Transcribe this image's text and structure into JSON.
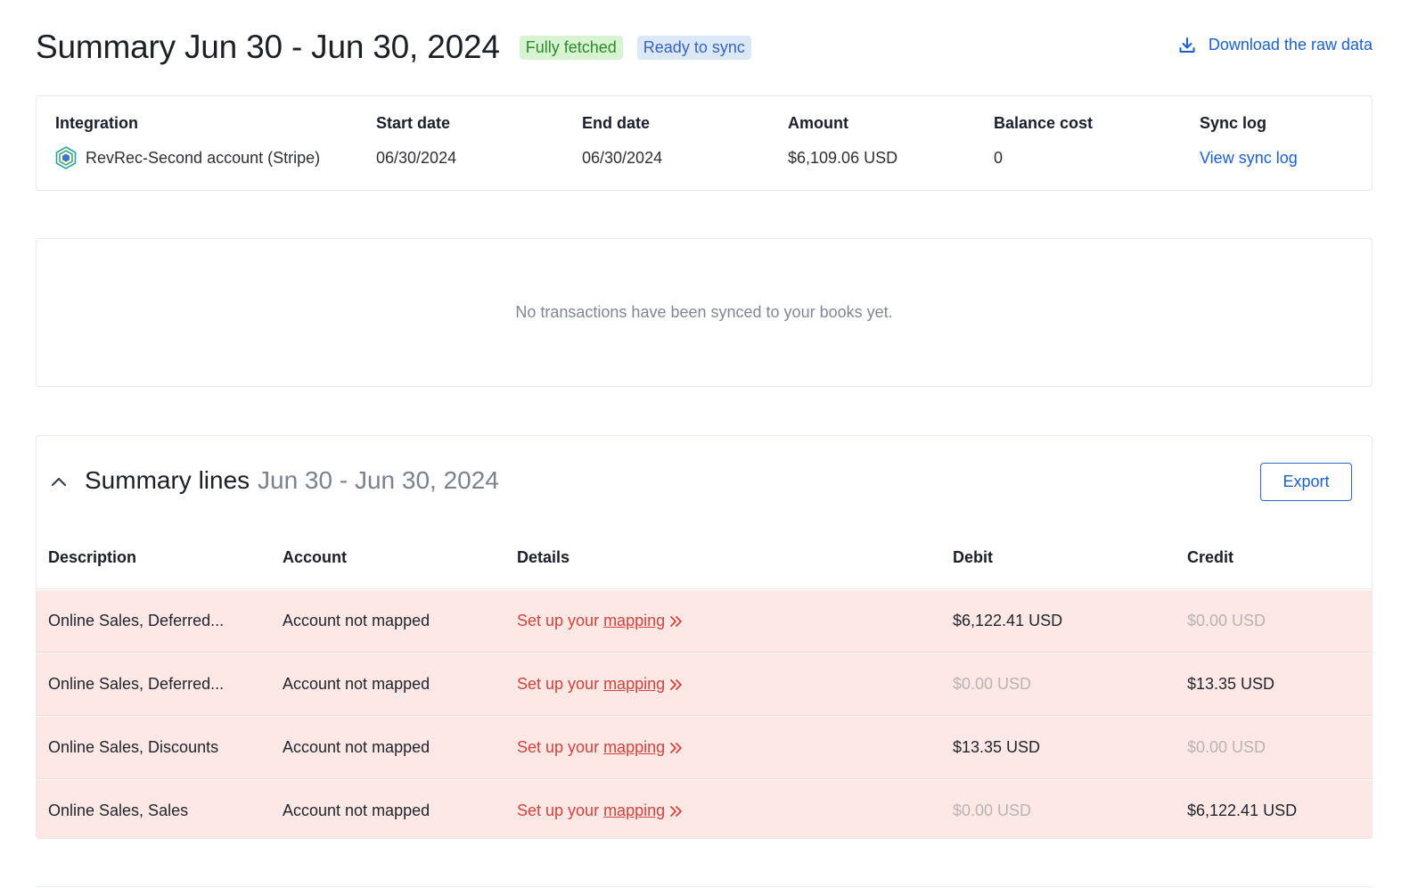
{
  "header": {
    "title": "Summary Jun 30 - Jun 30, 2024",
    "badges": [
      "Fully fetched",
      "Ready to sync"
    ],
    "download_label": "Download the raw data"
  },
  "info": {
    "columns": [
      {
        "label": "Integration",
        "value": "RevRec-Second account (Stripe)"
      },
      {
        "label": "Start date",
        "value": "06/30/2024"
      },
      {
        "label": "End date",
        "value": "06/30/2024"
      },
      {
        "label": "Amount",
        "value": "$6,109.06 USD"
      },
      {
        "label": "Balance cost",
        "value": "0"
      },
      {
        "label": "Sync log",
        "value": "View sync log"
      }
    ]
  },
  "empty_state": {
    "message": "No transactions have been synced to your books yet."
  },
  "summary_lines": {
    "title": "Summary lines",
    "range": "Jun 30 - Jun 30, 2024",
    "export_label": "Export",
    "columns": [
      "Description",
      "Account",
      "Details",
      "Debit",
      "Credit"
    ],
    "details_prefix": "Set up your",
    "details_link": "mapping",
    "rows": [
      {
        "description": "Online Sales, Deferred...",
        "account": "Account not mapped",
        "debit": "$6,122.41 USD",
        "credit": "$0.00 USD"
      },
      {
        "description": "Online Sales, Deferred...",
        "account": "Account not mapped",
        "debit": "$0.00 USD",
        "credit": "$13.35 USD"
      },
      {
        "description": "Online Sales, Discounts",
        "account": "Account not mapped",
        "debit": "$13.35 USD",
        "credit": "$0.00 USD"
      },
      {
        "description": "Online Sales, Sales",
        "account": "Account not mapped",
        "debit": "$0.00 USD",
        "credit": "$6,122.41 USD"
      }
    ]
  },
  "icons": {
    "download": "download-icon",
    "integration": "stripe-logo-icon",
    "collapse": "chevron-up-icon",
    "details_arrow": "double-chevron-right-icon"
  },
  "colors": {
    "accent": "#1a5fd0",
    "error_text": "#d8413b",
    "error_row_bg": "#fde8e6",
    "badge_green_bg": "#d8f3d2",
    "badge_blue_bg": "#dbe8f8"
  }
}
